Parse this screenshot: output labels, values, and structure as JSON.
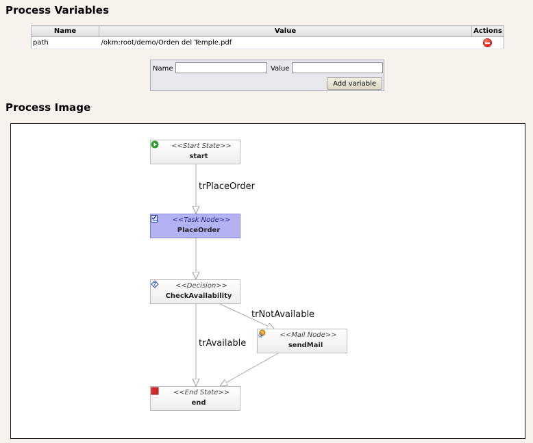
{
  "sections": {
    "variables_title": "Process Variables",
    "image_title": "Process Image"
  },
  "variables_table": {
    "headers": {
      "name": "Name",
      "value": "Value",
      "actions": "Actions"
    },
    "rows": [
      {
        "name": "path",
        "value": "/okm:root/demo/Orden del Temple.pdf",
        "action_icon": "delete-icon"
      }
    ]
  },
  "add_form": {
    "name_label": "Name",
    "name_value": "",
    "value_label": "Value",
    "value_value": "",
    "button_label": "Add variable"
  },
  "diagram": {
    "nodes": {
      "start": {
        "stereotype": "<<Start State>>",
        "name": "start",
        "icon": "play-icon"
      },
      "place_order": {
        "stereotype": "<<Task Node>>",
        "name": "PlaceOrder",
        "icon": "task-icon"
      },
      "check": {
        "stereotype": "<<Decision>>",
        "name": "CheckAvailability",
        "icon": "decision-icon"
      },
      "mail": {
        "stereotype": "<<Mail Node>>",
        "name": "sendMail",
        "icon": "mail-icon"
      },
      "end": {
        "stereotype": "<<End State>>",
        "name": "end",
        "icon": "stop-icon"
      }
    },
    "transitions": {
      "place_order": "trPlaceOrder",
      "not_available": "trNotAvailable",
      "available": "trAvailable"
    }
  },
  "colors": {
    "task_node_fill": "#b3b3f4",
    "delete_icon": "#d9241a",
    "start_icon": "#2e9a2e",
    "end_icon": "#d42a2a"
  }
}
